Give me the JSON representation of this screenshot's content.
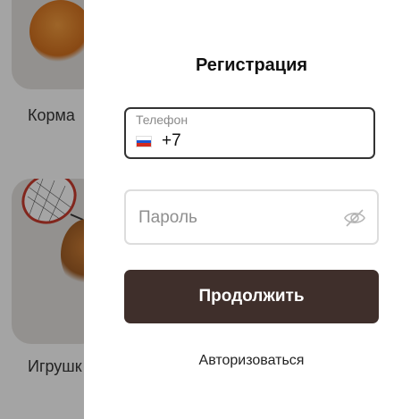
{
  "background": {
    "categories": [
      {
        "label": "Корма",
        "icon": "cat-photo"
      },
      {
        "label": "Игрушк",
        "icon": "cat-with-racket-photo"
      }
    ]
  },
  "modal": {
    "title": "Регистрация",
    "phone": {
      "label": "Телефон",
      "value": "+7",
      "flag": "russia-flag-icon"
    },
    "password": {
      "placeholder": "Пароль",
      "icon": "eye-off-icon"
    },
    "continue_label": "Продолжить",
    "login_link": "Авторизоваться"
  },
  "colors": {
    "button": "#3f2f2b",
    "active_border": "#333333",
    "inactive_border": "#dddddd"
  }
}
